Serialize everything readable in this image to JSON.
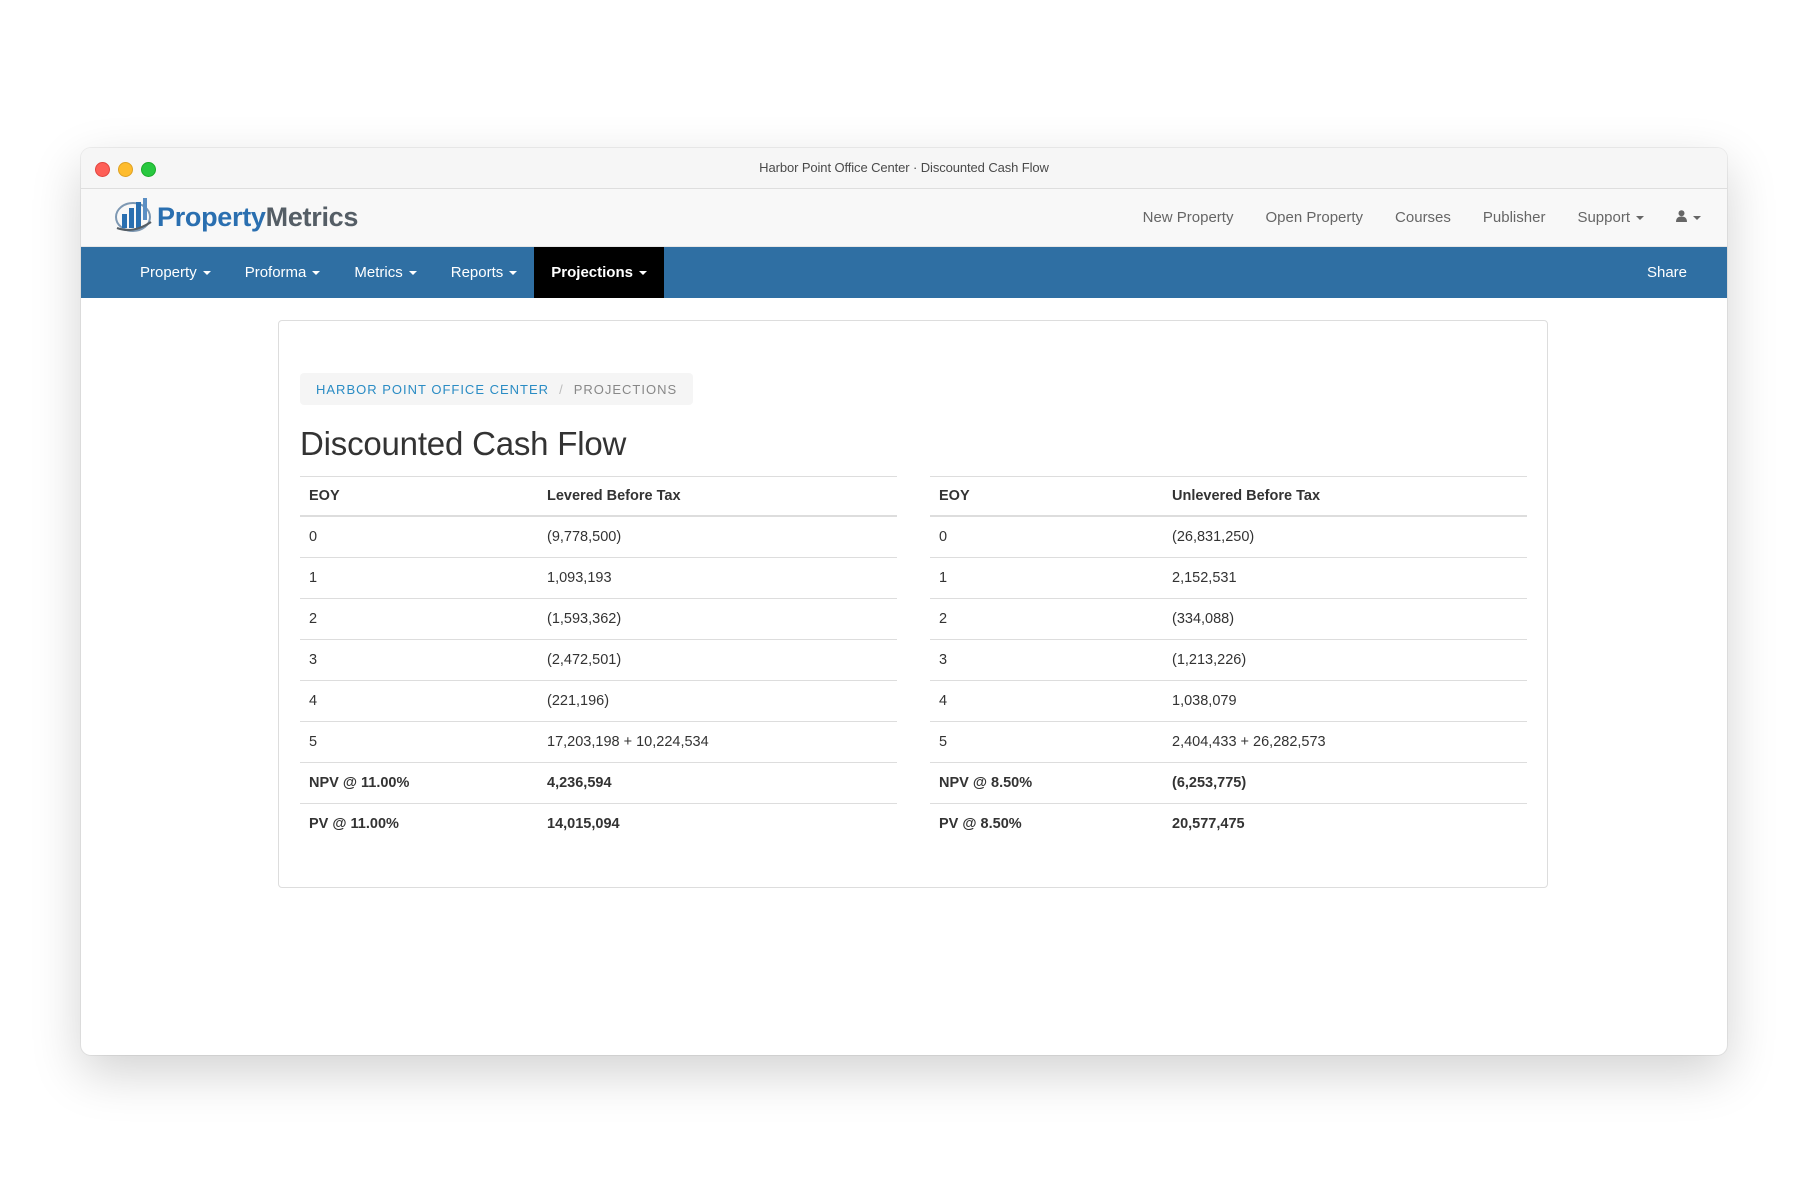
{
  "window": {
    "title": "Harbor Point Office Center · Discounted Cash Flow"
  },
  "brand": {
    "name_part1": "Property",
    "name_part2": "Metrics",
    "logo_icon": "bar-chart-globe-icon"
  },
  "top_links": {
    "new_property": "New Property",
    "open_property": "Open Property",
    "courses": "Courses",
    "publisher": "Publisher",
    "support": "Support",
    "user_icon": "user-icon"
  },
  "nav": {
    "items": [
      {
        "label": "Property"
      },
      {
        "label": "Proforma"
      },
      {
        "label": "Metrics"
      },
      {
        "label": "Reports"
      },
      {
        "label": "Projections"
      }
    ],
    "active": "Projections",
    "share": "Share"
  },
  "breadcrumb": {
    "parent": "Harbor Point Office Center",
    "separator": "/",
    "current": "Projections"
  },
  "page": {
    "title": "Discounted Cash Flow"
  },
  "levered": {
    "headers": [
      "EOY",
      "Levered Before Tax"
    ],
    "rows": [
      [
        "0",
        "(9,778,500)"
      ],
      [
        "1",
        "1,093,193"
      ],
      [
        "2",
        "(1,593,362)"
      ],
      [
        "3",
        "(2,472,501)"
      ],
      [
        "4",
        "(221,196)"
      ],
      [
        "5",
        "17,203,198 + 10,224,534"
      ]
    ],
    "npv": [
      "NPV @ 11.00%",
      "4,236,594"
    ],
    "pv": [
      "PV @ 11.00%",
      "14,015,094"
    ]
  },
  "unlevered": {
    "headers": [
      "EOY",
      "Unlevered Before Tax"
    ],
    "rows": [
      [
        "0",
        "(26,831,250)"
      ],
      [
        "1",
        "2,152,531"
      ],
      [
        "2",
        "(334,088)"
      ],
      [
        "3",
        "(1,213,226)"
      ],
      [
        "4",
        "1,038,079"
      ],
      [
        "5",
        "2,404,433 + 26,282,573"
      ]
    ],
    "npv": [
      "NPV @ 8.50%",
      "(6,253,775)"
    ],
    "pv": [
      "PV @ 8.50%",
      "20,577,475"
    ]
  },
  "colors": {
    "nav_bg": "#2f6fa3",
    "nav_active_bg": "#000000",
    "brand_blue": "#2a6fb0",
    "link_blue": "#2a8cc4"
  }
}
